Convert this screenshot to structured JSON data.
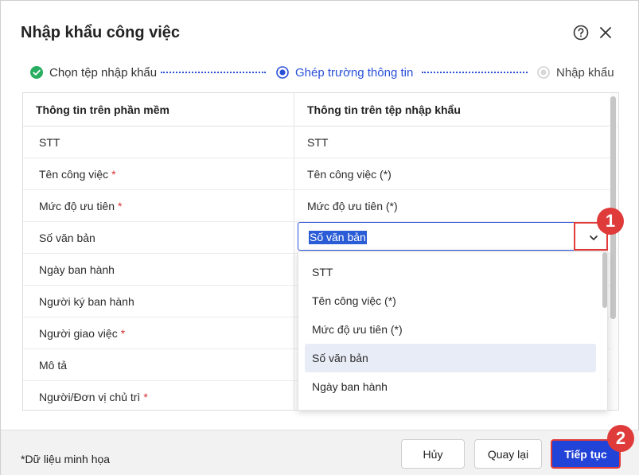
{
  "dialog": {
    "title": "Nhập khẩu công việc"
  },
  "stepper": {
    "steps": [
      {
        "label": "Chọn tệp nhập khẩu",
        "state": "done"
      },
      {
        "label": "Ghép trường thông tin",
        "state": "active"
      },
      {
        "label": "Nhập khẩu",
        "state": "pending"
      }
    ],
    "accent": "#2a50d8",
    "done_color": "#27ae60"
  },
  "table": {
    "headers": [
      "Thông tin trên phần mềm",
      "Thông tin trên tệp nhập khẩu"
    ],
    "rows": [
      {
        "field": "STT",
        "required": false,
        "mapped": "STT"
      },
      {
        "field": "Tên công việc",
        "required": true,
        "mapped": "Tên công việc (*)"
      },
      {
        "field": "Mức độ ưu tiên",
        "required": true,
        "mapped": "Mức độ ưu tiên (*)"
      },
      {
        "field": "Số văn bản",
        "required": false,
        "mapped": "Số văn bản"
      },
      {
        "field": "Ngày ban hành",
        "required": false,
        "mapped": ""
      },
      {
        "field": "Người ký ban hành",
        "required": false,
        "mapped": ""
      },
      {
        "field": "Người giao việc",
        "required": true,
        "mapped": ""
      },
      {
        "field": "Mô tả",
        "required": false,
        "mapped": ""
      },
      {
        "field": "Người/Đơn vị chủ trì",
        "required": true,
        "mapped": ""
      }
    ],
    "required_mark": "*"
  },
  "select": {
    "value": "Số văn bản",
    "options": [
      "STT",
      "Tên công việc (*)",
      "Mức độ ưu tiên (*)",
      "Số văn bản",
      "Ngày ban hành"
    ],
    "selected_index": 3
  },
  "annotations": {
    "badge_1": "1",
    "badge_2": "2",
    "highlight_color": "#e03b3b"
  },
  "footer": {
    "note": "*Dữ liệu minh họa",
    "cancel_label": "Hủy",
    "back_label": "Quay lại",
    "next_label": "Tiếp tục",
    "primary_color": "#2143d8"
  }
}
